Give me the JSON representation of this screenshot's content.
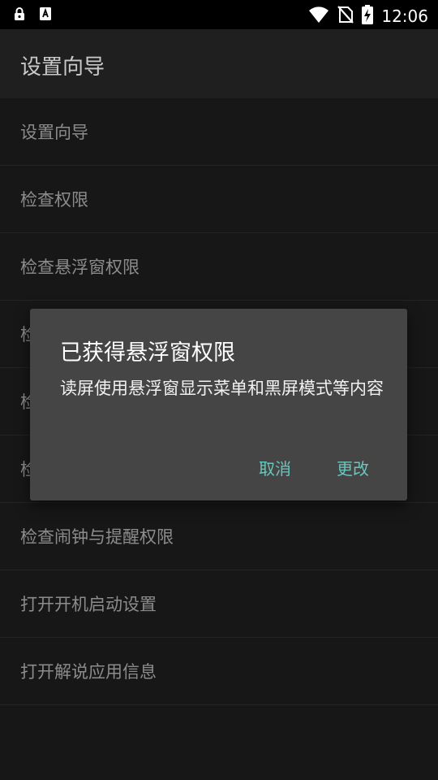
{
  "status_bar": {
    "time": "12:06",
    "icons": [
      "lock-notification-icon",
      "accessibility-icon",
      "wifi-icon",
      "no-sim-icon",
      "battery-charging-icon"
    ]
  },
  "app_bar": {
    "title": "设置向导"
  },
  "list": {
    "items": [
      {
        "label": "设置向导"
      },
      {
        "label": "检查权限"
      },
      {
        "label": "检查悬浮窗权限"
      },
      {
        "label": "检"
      },
      {
        "label": "检"
      },
      {
        "label": "检"
      },
      {
        "label": "检查闹钟与提醒权限"
      },
      {
        "label": "打开开机启动设置"
      },
      {
        "label": "打开解说应用信息"
      }
    ]
  },
  "dialog": {
    "title": "已获得悬浮窗权限",
    "message": "读屏使用悬浮窗显示菜单和黑屏模式等内容",
    "cancel_label": "取消",
    "change_label": "更改"
  },
  "colors": {
    "background": "#171717",
    "dialog_bg": "#454545",
    "accent": "#68c6bd"
  }
}
